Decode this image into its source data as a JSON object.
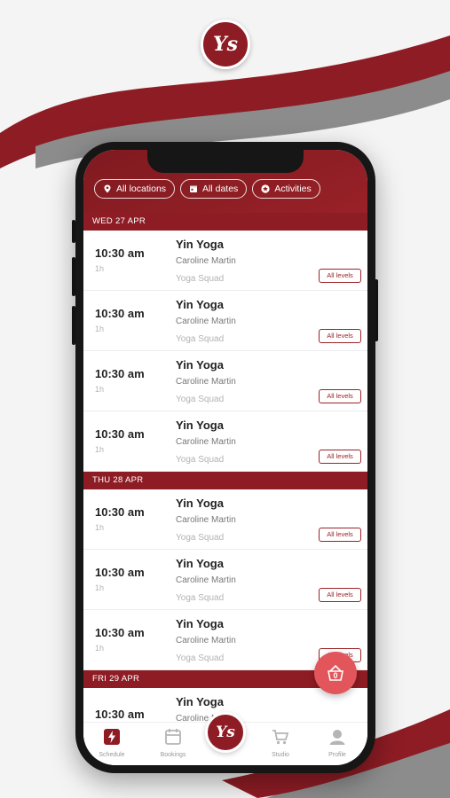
{
  "brand": {
    "logo_text": "Ys",
    "accent": "#8e1c24",
    "accent_light": "#e2565b"
  },
  "filters": [
    {
      "label": "All locations",
      "icon": "location-pin-icon"
    },
    {
      "label": "All dates",
      "icon": "calendar-icon"
    },
    {
      "label": "Activities",
      "icon": "star-icon"
    }
  ],
  "days": [
    {
      "label": "WED 27 APR"
    },
    {
      "label": "THU 28 APR"
    },
    {
      "label": "FRI 29 APR"
    }
  ],
  "classes": [
    {
      "time": "10:30 am",
      "duration": "1h",
      "title": "Yin Yoga",
      "teacher": "Caroline Martin",
      "studio": "Yoga Squad",
      "level": "All levels"
    },
    {
      "time": "10:30 am",
      "duration": "1h",
      "title": "Yin Yoga",
      "teacher": "Caroline Martin",
      "studio": "Yoga Squad",
      "level": "All levels"
    },
    {
      "time": "10:30 am",
      "duration": "1h",
      "title": "Yin Yoga",
      "teacher": "Caroline Martin",
      "studio": "Yoga Squad",
      "level": "All levels"
    },
    {
      "time": "10:30 am",
      "duration": "1h",
      "title": "Yin Yoga",
      "teacher": "Caroline Martin",
      "studio": "Yoga Squad",
      "level": "All levels"
    },
    {
      "time": "10:30 am",
      "duration": "1h",
      "title": "Yin Yoga",
      "teacher": "Caroline Martin",
      "studio": "Yoga Squad",
      "level": "All levels"
    },
    {
      "time": "10:30 am",
      "duration": "1h",
      "title": "Yin Yoga",
      "teacher": "Caroline Martin",
      "studio": "Yoga Squad",
      "level": "All levels"
    },
    {
      "time": "10:30 am",
      "duration": "1h",
      "title": "Yin Yoga",
      "teacher": "Caroline Martin",
      "studio": "Yoga Squad",
      "level": "All levels"
    },
    {
      "time": "10:30 am",
      "title": "Yin Yoga",
      "teacher": "Caroline Martin"
    }
  ],
  "cart": {
    "count": "0"
  },
  "nav": [
    {
      "label": "Schedule",
      "icon": "schedule-bolt-icon",
      "active": true
    },
    {
      "label": "Bookings",
      "icon": "calendar-icon"
    },
    {
      "label": "",
      "icon": "home-logo"
    },
    {
      "label": "Studio",
      "icon": "cart-icon"
    },
    {
      "label": "Profile",
      "icon": "user-icon"
    }
  ]
}
